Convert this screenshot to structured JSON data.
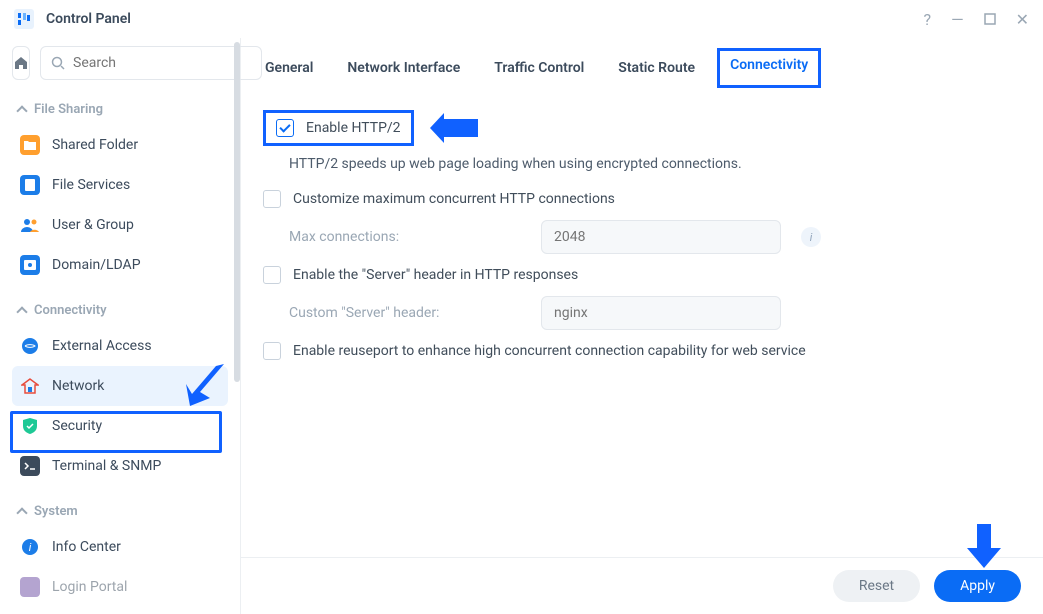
{
  "titlebar": {
    "title": "Control Panel"
  },
  "search": {
    "placeholder": "Search"
  },
  "sections": {
    "file_sharing": {
      "label": "File Sharing"
    },
    "connectivity": {
      "label": "Connectivity"
    },
    "system": {
      "label": "System"
    }
  },
  "sidebar": {
    "shared_folder": "Shared Folder",
    "file_services": "File Services",
    "user_group": "User & Group",
    "domain_ldap": "Domain/LDAP",
    "external_access": "External Access",
    "network": "Network",
    "security": "Security",
    "terminal_snmp": "Terminal & SNMP",
    "info_center": "Info Center",
    "login_portal": "Login Portal"
  },
  "tabs": {
    "general": "General",
    "network_interface": "Network Interface",
    "traffic_control": "Traffic Control",
    "static_route": "Static Route",
    "connectivity": "Connectivity"
  },
  "pane": {
    "enable_http2": "Enable HTTP/2",
    "http2_desc": "HTTP/2 speeds up web page loading when using encrypted connections.",
    "customize_max": "Customize maximum concurrent HTTP connections",
    "max_connections_label": "Max connections:",
    "max_connections_value": "2048",
    "server_header": "Enable the \"Server\" header in HTTP responses",
    "custom_server_label": "Custom \"Server\" header:",
    "custom_server_value": "nginx",
    "reuseport": "Enable reuseport to enhance high concurrent connection capability for web service"
  },
  "footer": {
    "reset": "Reset",
    "apply": "Apply"
  }
}
